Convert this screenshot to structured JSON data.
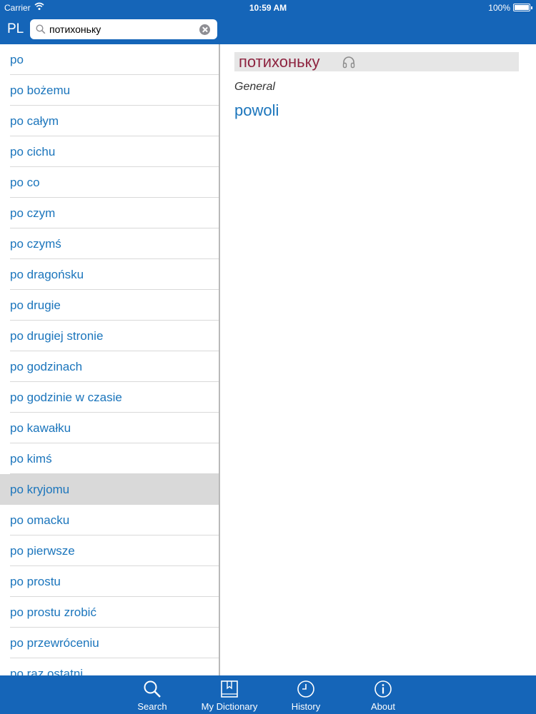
{
  "status": {
    "carrier": "Carrier",
    "time": "10:59 AM",
    "battery": "100%"
  },
  "header": {
    "lang": "PL",
    "search_value": "потихоньку"
  },
  "list": [
    "po",
    "po bożemu",
    "po całym",
    "po cichu",
    "po co",
    "po czym",
    "po czymś",
    "po dragońsku",
    "po drugie",
    "po drugiej stronie",
    "po godzinach",
    "po godzinie w czasie",
    "po kawałku",
    "po kimś",
    "po kryjomu",
    "po omacku",
    "po pierwsze",
    "po prostu",
    "po prostu zrobić",
    "po przewróceniu",
    "po raz ostatni"
  ],
  "selected_index": 14,
  "detail": {
    "headword": "потихоньку",
    "category": "General",
    "translation": "powoli"
  },
  "tabs": [
    "Search",
    "My Dictionary",
    "History",
    "About"
  ],
  "icons": {
    "search": "search-icon",
    "dictionary": "book-icon",
    "history": "clock-icon",
    "about": "info-icon",
    "audio": "headphones-icon",
    "wifi": "wifi-icon"
  }
}
